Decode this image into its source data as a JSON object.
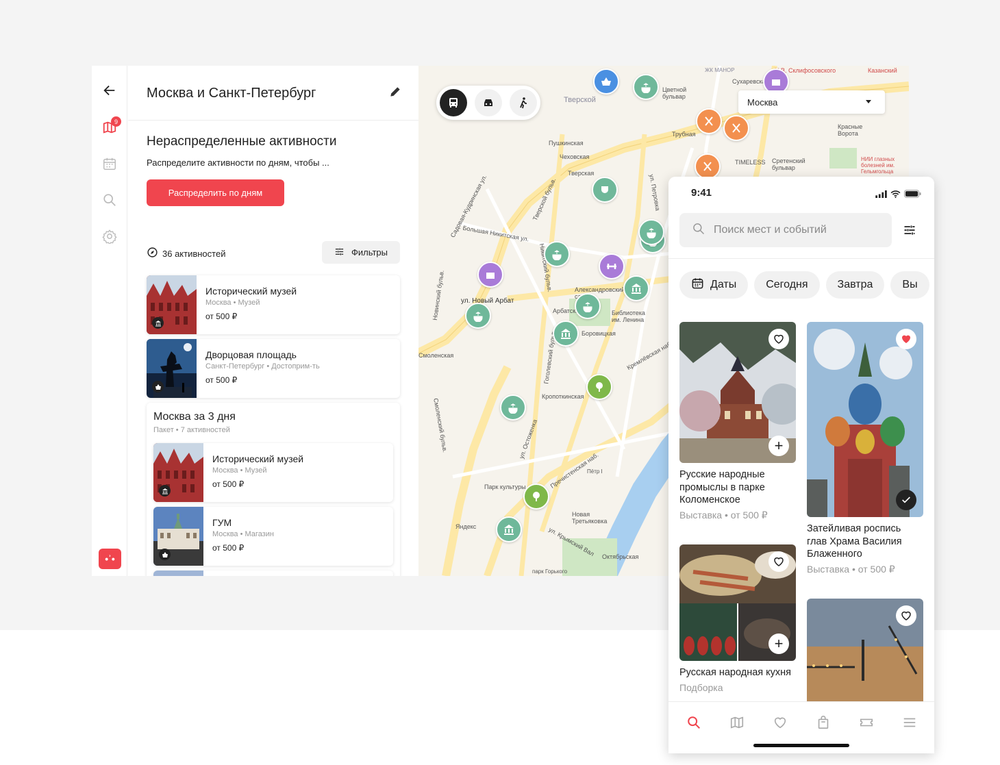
{
  "colors": {
    "accent": "#f0454e",
    "pin_green": "#6fb89a",
    "pin_food": "#f3904f",
    "pin_blue": "#4a90e2",
    "pin_purple": "#a97bd8"
  },
  "rail": {
    "icons": [
      "back-arrow-icon",
      "map-icon",
      "calendar-icon",
      "search-icon",
      "gear-icon"
    ],
    "map_badge": "9",
    "logo": "•ʾ•"
  },
  "panel": {
    "trip_title": "Москва и Санкт-Петербург",
    "unassigned_title": "Нераспределенные активности",
    "unassigned_subtitle": "Распределите активности по дням, чтобы ...",
    "distribute_button": "Распределить по дням",
    "activities_count": "36 активностей",
    "filters_button": "Фильтры",
    "cards": [
      {
        "title": "Исторический музей",
        "meta": "Москва • Музей",
        "price": "от 500 ₽",
        "category_icon": "museum-icon"
      },
      {
        "title": "Дворцовая площадь",
        "meta": "Санкт-Петербург • Достоприм-ть",
        "price": "от 500 ₽",
        "category_icon": "basket-icon"
      }
    ],
    "package": {
      "title": "Москва за 3 дня",
      "subtitle": "Пакет • 7 активностей",
      "cards": [
        {
          "title": "Исторический музей",
          "meta": "Москва • Музей",
          "price": "от 500 ₽",
          "category_icon": "museum-icon"
        },
        {
          "title": "ГУМ",
          "meta": "Москва • Магазин",
          "price": "от 500 ₽",
          "category_icon": "basket-icon"
        }
      ]
    }
  },
  "map": {
    "transport_modes": [
      "bus-icon",
      "car-icon",
      "walk-icon"
    ],
    "city_select": "Москва",
    "labels": [
      "Тверской",
      "Пушкинская",
      "Чеховская",
      "Тверская",
      "Трубная",
      "Сухаревская",
      "Цветной бульвар",
      "Сретенский бульвар",
      "Красные Ворота",
      "TIMELESS",
      "Арбатская",
      "Александровский сад",
      "Библиотека им. Ленина",
      "Боровицкая",
      "Кропоткинская",
      "Парк культуры",
      "Новая Третьяковка",
      "Октябрьская",
      "парк Горького",
      "Яндекс",
      "ул. Новый Арбат",
      "Кремлёвская наб.",
      "Пречистенская наб.",
      "ул. Крымский Вал",
      "Садовая-Кудринская ул.",
      "Новинский бульв.",
      "Смоленский бульв.",
      "Гоголевский бульв.",
      "ул. Остоженка",
      "Никитский бульв.",
      "Тверской бульв.",
      "Большая Никитская ул.",
      "ул. Петровка",
      "Н.В. Склифосовского",
      "НИИ глазных болезней им. Гельмгольца",
      "ЖК МАНОР",
      "Казанский",
      "Смоленская",
      "Пётр I"
    ]
  },
  "phone": {
    "time": "9:41",
    "search_placeholder": "Поиск мест и событий",
    "chips": [
      "Даты",
      "Сегодня",
      "Завтра",
      "Вы"
    ],
    "cards": [
      {
        "name": "Русские народные промыслы в парке Коломенское",
        "meta": "Выставка • от 500 ₽",
        "liked": false
      },
      {
        "name": "Затейливая роспись глав Храма Василия Блаженного",
        "meta": "Выставка • от 500 ₽",
        "liked": true
      },
      {
        "name": "Русская народная кухня",
        "meta": "Подборка",
        "liked": false
      },
      {
        "name": "",
        "meta": "",
        "liked": false
      }
    ],
    "tabs": [
      "search-icon",
      "map-icon",
      "heart-icon",
      "bag-icon",
      "ticket-icon",
      "menu-icon"
    ]
  }
}
